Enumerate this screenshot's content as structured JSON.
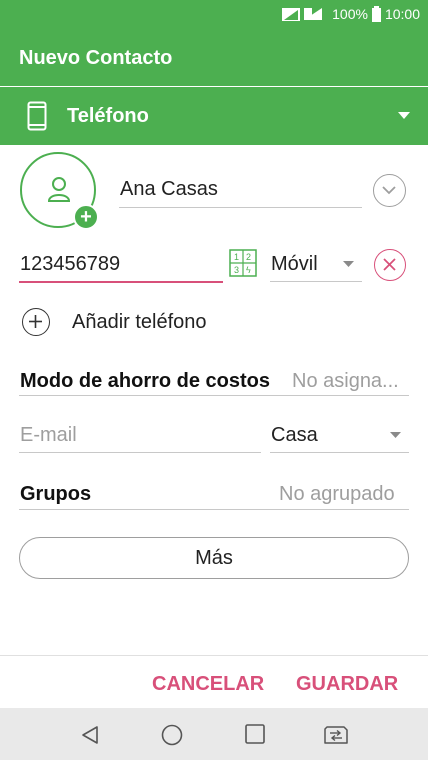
{
  "status_bar": {
    "battery": "100%",
    "time": "10:00"
  },
  "app_bar": {
    "title": "Nuevo Contacto"
  },
  "account": {
    "label": "Teléfono"
  },
  "name": {
    "value": "Ana Casas"
  },
  "phone": {
    "value": "123456789",
    "type": "Móvil"
  },
  "add_phone": {
    "label": "Añadir teléfono"
  },
  "cost_saving": {
    "label": "Modo de ahorro de costos",
    "value": "No asigna..."
  },
  "email": {
    "placeholder": "E-mail",
    "type": "Casa"
  },
  "groups": {
    "label": "Grupos",
    "value": "No agrupado"
  },
  "more_button": {
    "label": "Más"
  },
  "actions": {
    "cancel": "CANCELAR",
    "save": "GUARDAR"
  },
  "colors": {
    "primary": "#4caf50",
    "accent": "#d8507a"
  },
  "icons": [
    "signal-icon",
    "battery-icon",
    "phone-icon",
    "dropdown-arrow-icon",
    "avatar-icon",
    "add-photo-icon",
    "expand-icon",
    "dialpad-icon",
    "remove-icon",
    "add-icon",
    "back-icon",
    "home-icon",
    "recents-icon",
    "switch-sim-icon"
  ]
}
